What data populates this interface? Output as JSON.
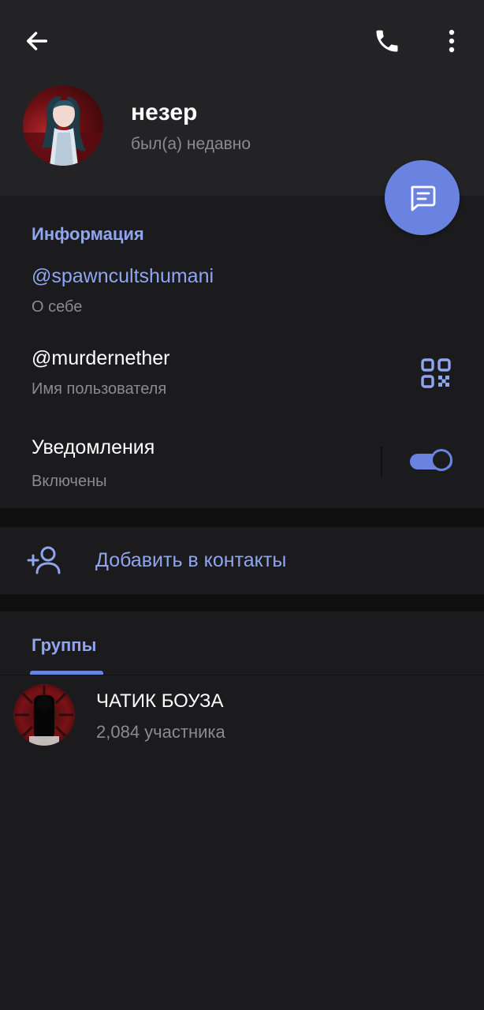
{
  "profile": {
    "name": "незер",
    "status": "был(а) недавно"
  },
  "info": {
    "section_title": "Информация",
    "bio_value": "@spawncultshumani",
    "bio_label": "О себе",
    "username_value": "@murdernether",
    "username_label": "Имя пользователя",
    "notifications_title": "Уведомления",
    "notifications_state": "Включены",
    "notifications_enabled": true
  },
  "actions": {
    "add_contact_label": "Добавить в контакты"
  },
  "groups": {
    "tab_label": "Группы",
    "items": [
      {
        "name": "ЧАТИК БОУЗА",
        "members": "2,084 участника"
      }
    ]
  },
  "colors": {
    "accent": "#8fa5f0",
    "fab": "#6b83e0",
    "background": "#1b1b1d",
    "header_background": "#232325",
    "secondary_text": "#8b8b8f"
  },
  "icons": {
    "back": "arrow-left-icon",
    "call": "phone-icon",
    "more": "more-vertical-icon",
    "message": "message-icon",
    "qr": "qr-code-icon",
    "add_contact": "add-user-icon"
  }
}
